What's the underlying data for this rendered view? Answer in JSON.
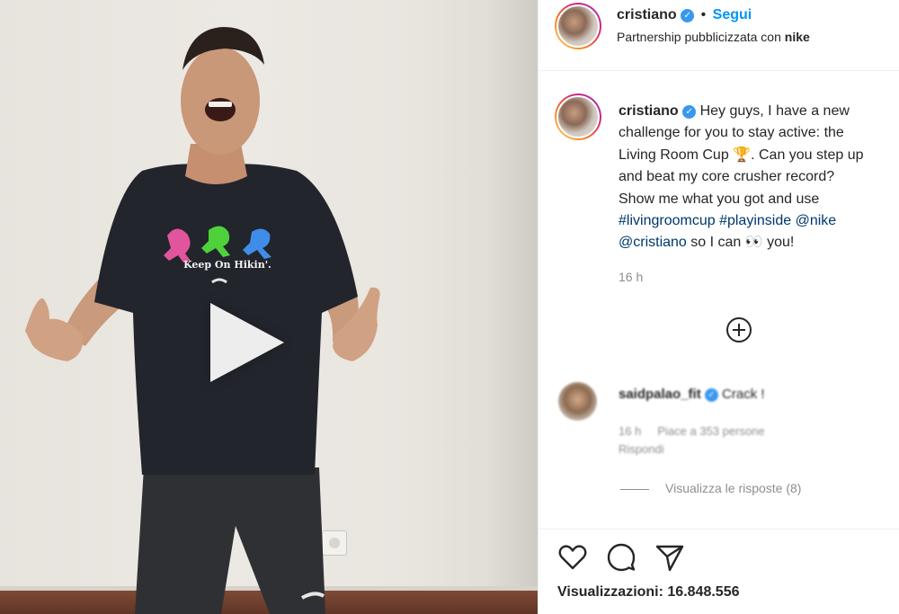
{
  "header": {
    "username": "cristiano",
    "separator": "•",
    "follow_label": "Segui",
    "partnership_prefix": "Partnership pubblicizzata con",
    "partner": "nike"
  },
  "media": {
    "shirt_text": "Keep On Hikin'."
  },
  "caption": {
    "username": "cristiano",
    "line1": "Hey guys, I have a new",
    "line2": "challenge for you to stay active: the",
    "line3": "Living Room Cup 🏆. Can you step up",
    "line4": "and beat my core crusher record?",
    "line5": "Show me what you got and use",
    "hashtag1": "#livingroomcup",
    "hashtag2": "#playinside",
    "mention1": "@nike",
    "mention2": "@cristiano",
    "line6_tail": "so I can 👀 you!",
    "timestamp": "16 h"
  },
  "comment": {
    "username": "saidpalao_fit",
    "text": "Crack !",
    "time": "16 h",
    "likes": "Piace a 353 persone",
    "reply_label": "Rispondi"
  },
  "view_replies_label": "Visualizza le risposte (8)",
  "views": {
    "label": "Visualizzazioni:",
    "count": "16.848.556"
  },
  "colors": {
    "follow": "#0095f6",
    "verified": "#3897f0",
    "link": "#00376b",
    "muted": "#8e8e8e"
  },
  "icons": [
    "heart-icon",
    "comment-icon",
    "share-icon",
    "verified-icon",
    "plus-circle-icon",
    "play-icon"
  ]
}
